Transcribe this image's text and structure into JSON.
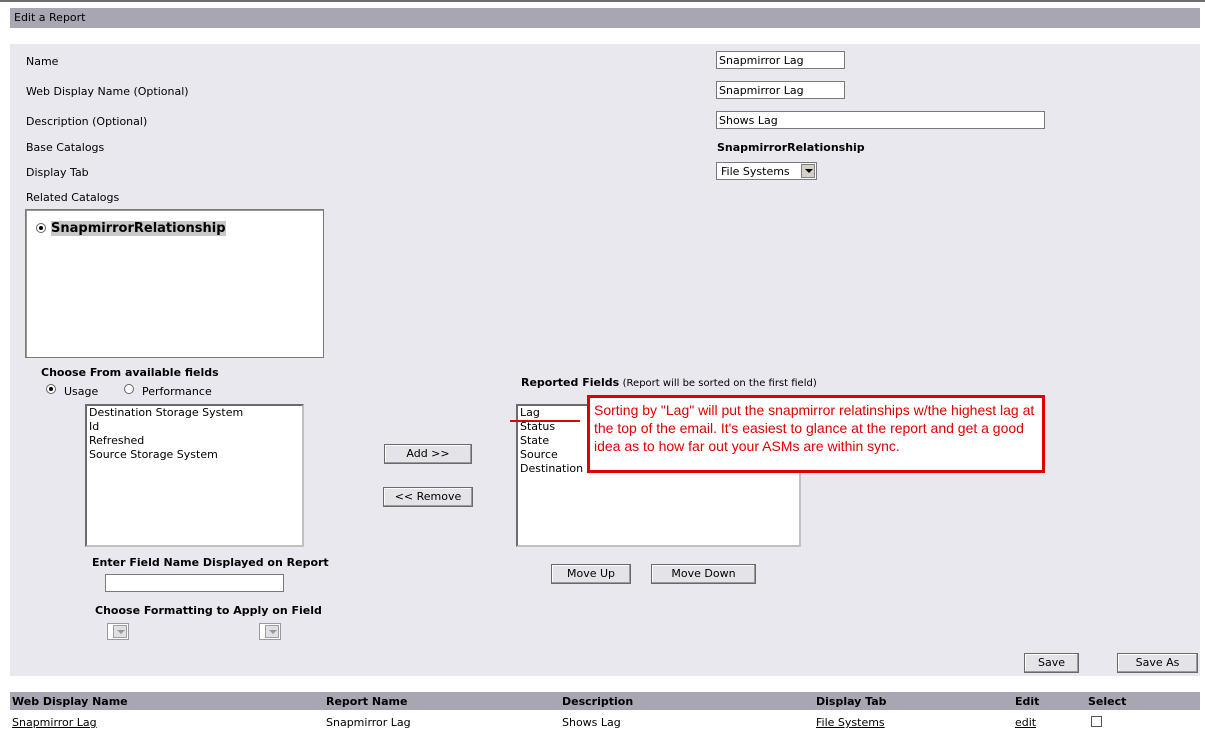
{
  "page": {
    "title": "Edit a Report"
  },
  "form": {
    "name_label": "Name",
    "name_value": "Snapmirror Lag",
    "web_display_label": "Web Display Name (Optional)",
    "web_display_value": "Snapmirror Lag",
    "description_label": "Description (Optional)",
    "description_value": "Shows Lag",
    "base_catalogs_label": "Base Catalogs",
    "base_catalogs_value": "SnapmirrorRelationship",
    "display_tab_label": "Display Tab",
    "display_tab_value": "File Systems",
    "related_catalogs_label": "Related Catalogs",
    "related_catalog_selected": "SnapmirrorRelationship"
  },
  "fields": {
    "choose_title": "Choose From available fields",
    "radio_usage": "Usage",
    "radio_performance": "Performance",
    "available": [
      "Destination Storage System",
      "Id",
      "Refreshed",
      "Source Storage System"
    ],
    "add_button": "Add >>",
    "remove_button": "<< Remove",
    "reported_title": "Reported Fields",
    "reported_note": "(Report will be sorted on the first field)",
    "reported": [
      "Lag",
      "Status",
      "State",
      "Source",
      "Destination"
    ],
    "move_up": "Move Up",
    "move_down": "Move Down",
    "enter_field_name_label": "Enter Field Name Displayed on Report",
    "formatting_label": "Choose Formatting to Apply on Field"
  },
  "annotation": {
    "text": "Sorting by \"Lag\" will put the snapmirror relatinships w/the highest lag at the top of the email.  It's easiest to glance at the report and get a good idea as to how far out your ASMs are within sync.",
    "color": "#e00000"
  },
  "actions": {
    "save": "Save",
    "save_as": "Save As"
  },
  "table": {
    "headers": [
      "Web Display Name",
      "Report Name",
      "Description",
      "Display Tab",
      "Edit",
      "Select"
    ],
    "rows": [
      {
        "web_display_name": "Snapmirror Lag",
        "report_name": "Snapmirror Lag",
        "description": "Shows Lag",
        "display_tab": "File Systems",
        "edit": "edit"
      }
    ]
  },
  "colors": {
    "header_bar": "#a9a6b4",
    "panel_bg": "#e9e8ef"
  }
}
